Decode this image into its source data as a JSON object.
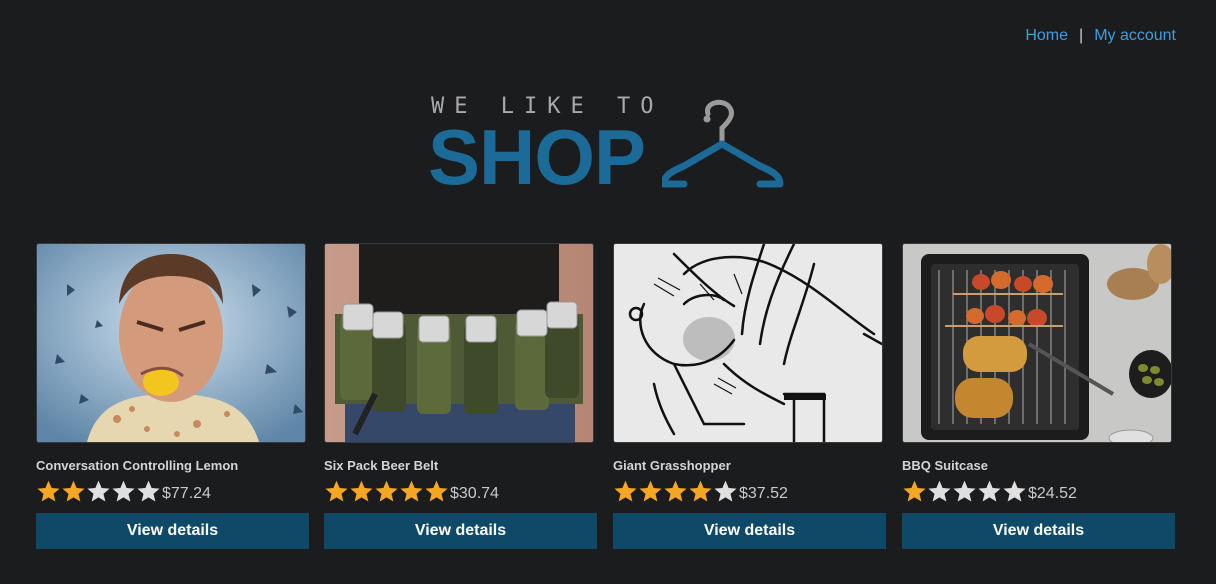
{
  "nav": {
    "home_label": "Home",
    "separator": "|",
    "account_label": "My account"
  },
  "logo": {
    "top_text": "WE LIKE TO",
    "main_text": "SHOP",
    "icon": "hanger-icon"
  },
  "colors": {
    "accent": "#0e4a67",
    "link": "#3d9fe0",
    "logo_blue": "#1b6a97",
    "star_filled": "#f5a623",
    "star_empty": "#e0e0e0"
  },
  "products": [
    {
      "name": "Conversation Controlling Lemon",
      "rating": 2,
      "price": "$77.24",
      "button_label": "View details",
      "image": "man-with-lemon-in-mouth"
    },
    {
      "name": "Six Pack Beer Belt",
      "rating": 5,
      "price": "$30.74",
      "button_label": "View details",
      "image": "camouflage-beer-belt"
    },
    {
      "name": "Giant Grasshopper",
      "rating": 4,
      "price": "$37.52",
      "button_label": "View details",
      "image": "sketch-grasshopper-on-man"
    },
    {
      "name": "BBQ Suitcase",
      "rating": 1,
      "price": "$24.52",
      "button_label": "View details",
      "image": "bbq-grill-with-skewers"
    }
  ]
}
